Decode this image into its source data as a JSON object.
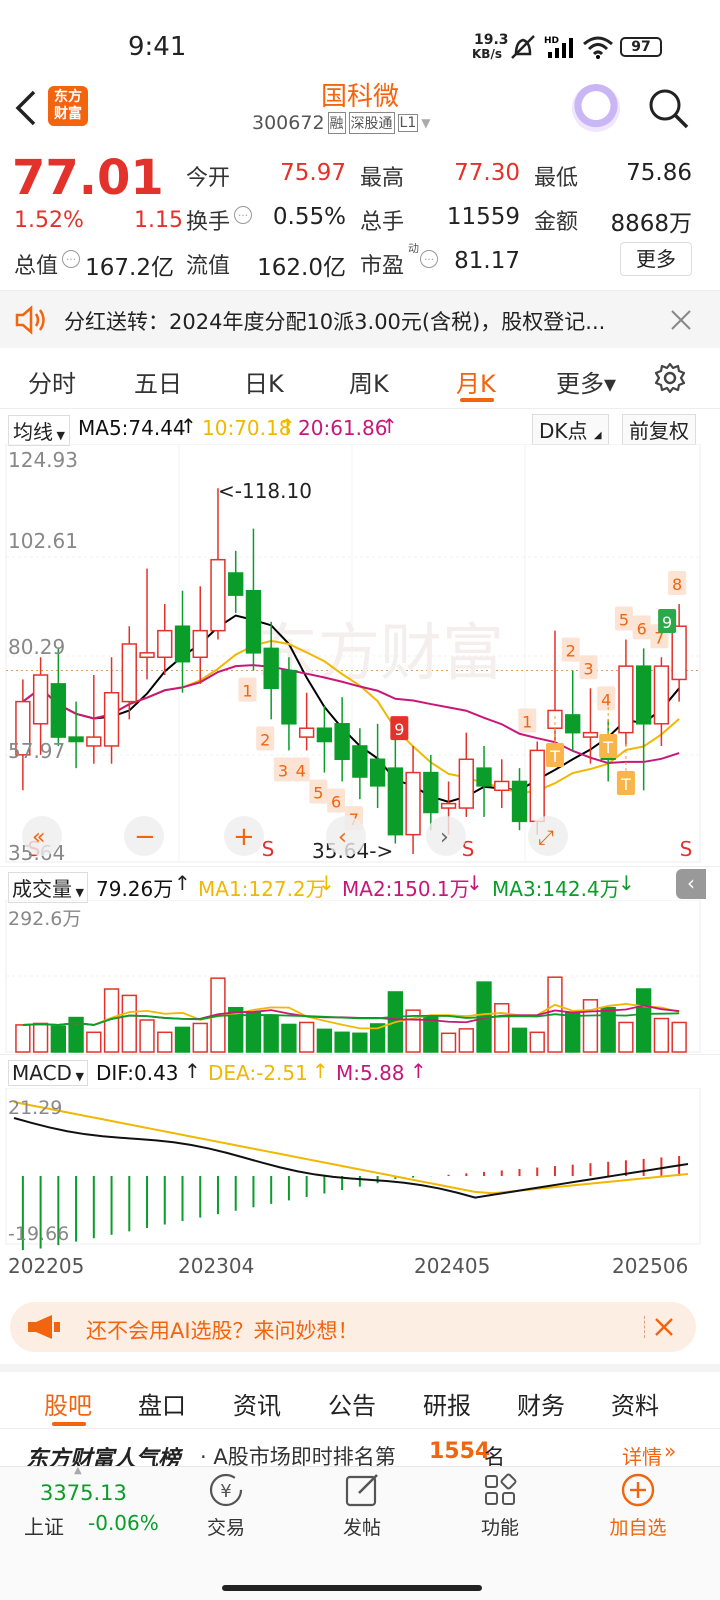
{
  "status_bar": {
    "time": "9:41",
    "net_speed_top": "19.3",
    "net_speed_bottom": "KB/s",
    "battery": "97"
  },
  "header": {
    "brand_line1": "东方",
    "brand_line2": "财富",
    "stock_name": "国科微",
    "code": "300672",
    "tag_margin": "融",
    "tag_connect": "深股通",
    "tag_level": "L1"
  },
  "quote": {
    "price": "77.01",
    "change_pct": "1.52%",
    "change": "1.15",
    "open_label": "今开",
    "open": "75.97",
    "high_label": "最高",
    "high": "77.30",
    "low_label": "最低",
    "low": "75.86",
    "turnover_label": "换手",
    "turnover": "0.55%",
    "volume_label": "总手",
    "volume": "11559",
    "amount_label": "金额",
    "amount": "8868万",
    "mcap_label": "总值",
    "mcap": "167.2亿",
    "float_label": "流值",
    "float": "162.0亿",
    "pe_label": "市盈",
    "pe_sup": "动",
    "pe": "81.17",
    "more": "更多"
  },
  "notice": {
    "text": "分红送转：2024年度分配10派3.00元(含税)，股权登记..."
  },
  "tabs": [
    "分时",
    "五日",
    "日K",
    "周K",
    "月K",
    "更多▾"
  ],
  "active_tab": 4,
  "ma_bar": {
    "selector": "均线",
    "ma5": "MA5:74.44",
    "ma10": "10:70.18",
    "ma20": "20:61.86",
    "dk": "DK点",
    "adjust": "前复权"
  },
  "kline": {
    "y_labels": [
      "124.93",
      "102.61",
      "80.29",
      "57.97",
      "35.64"
    ],
    "max_label": "<-118.10",
    "min_label": "35.64->",
    "watermark": "东方财富"
  },
  "volume_bar": {
    "selector": "成交量",
    "vol": "79.26万",
    "ma1": "MA1:127.2万",
    "ma2": "MA2:150.1万",
    "ma3": "MA3:142.4万",
    "y_top": "292.6万"
  },
  "macd_bar": {
    "selector": "MACD",
    "dif": "DIF:0.43",
    "dea": "DEA:-2.51",
    "m": "M:5.88",
    "y_top": "21.29",
    "y_bottom": "-19.66"
  },
  "x_labels": [
    "202205",
    "202304",
    "202405",
    "202506"
  ],
  "ai_banner": {
    "text": "还不会用AI选股？来问妙想！"
  },
  "bottom_tabs": [
    "股吧",
    "盘口",
    "资讯",
    "公告",
    "研报",
    "财务",
    "资料"
  ],
  "rank": {
    "title": "东方财富人气榜",
    "text": "· A股市场即时排名第",
    "number": "1554",
    "suffix": "名",
    "detail": "详情"
  },
  "footer": {
    "index_value": "3375.13",
    "index_name": "上证",
    "index_change": "-0.06%",
    "trade": "交易",
    "post": "发帖",
    "func": "功能",
    "add": "加自选"
  },
  "colors": {
    "up": "#e3322b",
    "down": "#0a9d2a",
    "accent": "#f2640e",
    "ma5": "#000000",
    "ma10": "#f0b800",
    "ma20": "#c8177a"
  },
  "chart_data": {
    "type": "candlestick",
    "period": "monthly",
    "y_range": [
      35.64,
      124.93
    ],
    "candles": [
      {
        "o": 58,
        "c": 70,
        "h": 75,
        "l": 50
      },
      {
        "o": 65,
        "c": 76,
        "h": 80,
        "l": 58
      },
      {
        "o": 74,
        "c": 62,
        "h": 82,
        "l": 60
      },
      {
        "o": 62,
        "c": 61,
        "h": 70,
        "l": 55
      },
      {
        "o": 60,
        "c": 62,
        "h": 76,
        "l": 56
      },
      {
        "o": 60,
        "c": 72,
        "h": 80,
        "l": 56
      },
      {
        "o": 70,
        "c": 83,
        "h": 87,
        "l": 66
      },
      {
        "o": 80,
        "c": 81,
        "h": 100,
        "l": 75
      },
      {
        "o": 80,
        "c": 86,
        "h": 92,
        "l": 76
      },
      {
        "o": 87,
        "c": 79,
        "h": 95,
        "l": 72
      },
      {
        "o": 80,
        "c": 86,
        "h": 96,
        "l": 74
      },
      {
        "o": 86,
        "c": 102,
        "h": 118.1,
        "l": 84
      },
      {
        "o": 99,
        "c": 94,
        "h": 104,
        "l": 90
      },
      {
        "o": 95,
        "c": 81,
        "h": 109,
        "l": 77
      },
      {
        "o": 82,
        "c": 73,
        "h": 88,
        "l": 66
      },
      {
        "o": 77,
        "c": 65,
        "h": 80,
        "l": 59
      },
      {
        "o": 62,
        "c": 64,
        "h": 72,
        "l": 59
      },
      {
        "o": 64,
        "c": 61,
        "h": 69,
        "l": 54
      },
      {
        "o": 65,
        "c": 57,
        "h": 71,
        "l": 52
      },
      {
        "o": 60,
        "c": 53,
        "h": 64,
        "l": 48
      },
      {
        "o": 57,
        "c": 51,
        "h": 65,
        "l": 46
      },
      {
        "o": 55,
        "c": 40,
        "h": 62,
        "l": 38
      },
      {
        "o": 40,
        "c": 54,
        "h": 60,
        "l": 35.64
      },
      {
        "o": 54,
        "c": 45,
        "h": 58,
        "l": 41
      },
      {
        "o": 46,
        "c": 47,
        "h": 52,
        "l": 40
      },
      {
        "o": 46,
        "c": 57,
        "h": 63,
        "l": 44
      },
      {
        "o": 55,
        "c": 51,
        "h": 60,
        "l": 44
      },
      {
        "o": 50,
        "c": 52,
        "h": 57,
        "l": 46
      },
      {
        "o": 52,
        "c": 43,
        "h": 55,
        "l": 41
      },
      {
        "o": 43,
        "c": 59,
        "h": 61,
        "l": 40
      },
      {
        "o": 64,
        "c": 68,
        "h": 86,
        "l": 58
      },
      {
        "o": 67,
        "c": 63,
        "h": 77,
        "l": 59
      },
      {
        "o": 62,
        "c": 63,
        "h": 73,
        "l": 56
      },
      {
        "o": 61,
        "c": 57,
        "h": 66,
        "l": 52
      },
      {
        "o": 63,
        "c": 78,
        "h": 84,
        "l": 60
      },
      {
        "o": 78,
        "c": 65,
        "h": 82,
        "l": 50
      },
      {
        "o": 65,
        "c": 78,
        "h": 80,
        "l": 60
      },
      {
        "o": 75,
        "c": 87,
        "h": 92,
        "l": 70
      }
    ],
    "volume_ylim": [
      0,
      292.6
    ]
  }
}
